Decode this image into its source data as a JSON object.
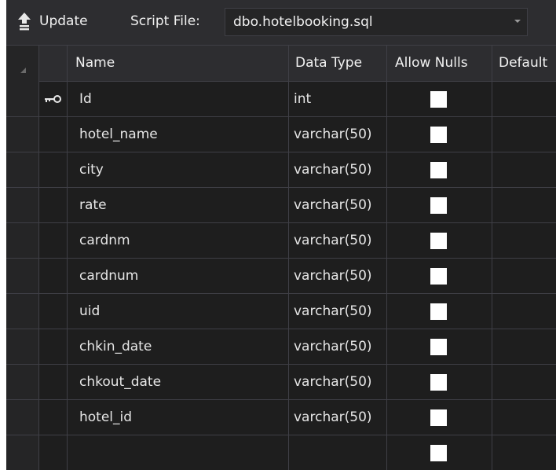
{
  "toolbar": {
    "update_label": "Update",
    "script_file_label": "Script File:",
    "script_file_value": "dbo.hotelbooking.sql"
  },
  "columns": {
    "name": "Name",
    "data_type": "Data Type",
    "allow_nulls": "Allow Nulls",
    "default": "Default"
  },
  "rows": [
    {
      "name": "Id",
      "type": "int",
      "primary_key": true
    },
    {
      "name": "hotel_name",
      "type": "varchar(50)"
    },
    {
      "name": "city",
      "type": "varchar(50)"
    },
    {
      "name": "rate",
      "type": "varchar(50)"
    },
    {
      "name": "cardnm",
      "type": "varchar(50)"
    },
    {
      "name": "cardnum",
      "type": "varchar(50)"
    },
    {
      "name": "uid",
      "type": "varchar(50)"
    },
    {
      "name": "chkin_date",
      "type": "varchar(50)"
    },
    {
      "name": "chkout_date",
      "type": "varchar(50)"
    },
    {
      "name": "hotel_id",
      "type": "varchar(50)"
    },
    {
      "name": "",
      "type": ""
    }
  ],
  "colors": {
    "background": "#1e1e1e",
    "header_bg": "#2d2d30",
    "grid_line": "#3f3f46",
    "checkbox": "#ffffff"
  },
  "icons": {
    "update": "upload-arrow-icon",
    "primary_key": "key-icon",
    "dropdown": "chevron-down-icon"
  }
}
